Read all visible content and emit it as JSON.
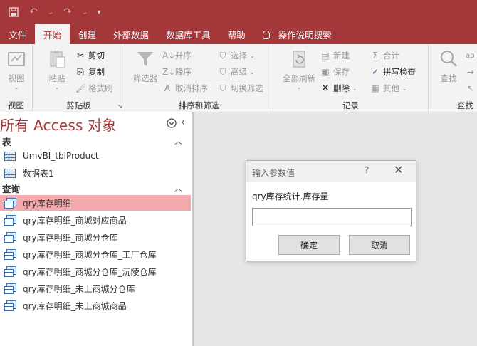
{
  "quick_access": {
    "save_icon": "save-icon",
    "undo_icon": "undo-icon",
    "redo_icon": "redo-icon",
    "customize_icon": "customize-qat-icon"
  },
  "tabs": [
    {
      "label": "文件"
    },
    {
      "label": "开始"
    },
    {
      "label": "创建"
    },
    {
      "label": "外部数据"
    },
    {
      "label": "数据库工具"
    },
    {
      "label": "帮助"
    },
    {
      "label": "操作说明搜索"
    }
  ],
  "ribbon": {
    "views": {
      "view_label": "视图",
      "group_label": "视图"
    },
    "clipboard": {
      "paste_label": "粘贴",
      "cut_label": "剪切",
      "copy_label": "复制",
      "format_painter_label": "格式刷",
      "group_label": "剪贴板"
    },
    "sort_filter": {
      "filter_label": "筛选器",
      "asc_label": "升序",
      "desc_label": "降序",
      "clear_sort_label": "取消排序",
      "selection_label": "选择",
      "advanced_label": "高级",
      "toggle_filter_label": "切换筛选",
      "group_label": "排序和筛选"
    },
    "records": {
      "refresh_label": "全部刷新",
      "new_label": "新建",
      "save_label": "保存",
      "delete_label": "删除",
      "totals_label": "合计",
      "spelling_label": "拼写检查",
      "more_label": "其他",
      "group_label": "记录"
    },
    "find": {
      "find_label": "查找",
      "group_label": "查找"
    }
  },
  "nav": {
    "title": "所有 Access 对象",
    "sections": [
      {
        "label": "表",
        "items": [
          {
            "label": "UmvBI_tblProduct"
          },
          {
            "label": "数据表1"
          }
        ]
      },
      {
        "label": "查询",
        "items": [
          {
            "label": "qry库存明细",
            "selected": true
          },
          {
            "label": "qry库存明细_商城对应商品"
          },
          {
            "label": "qry库存明细_商城分仓库"
          },
          {
            "label": "qry库存明细_商城分仓库_工厂仓库"
          },
          {
            "label": "qry库存明细_商城分仓库_沅陵仓库"
          },
          {
            "label": "qry库存明细_未上商城分仓库"
          },
          {
            "label": "qry库存明细_未上商城商品"
          }
        ]
      }
    ]
  },
  "dialog": {
    "title": "输入参数值",
    "help": "?",
    "close": "✕",
    "prompt": "qry库存统计.库存量",
    "input_value": "",
    "ok_label": "确定",
    "cancel_label": "取消"
  },
  "colors": {
    "accent": "#a4373a",
    "selected_row": "#f4a9ac"
  }
}
